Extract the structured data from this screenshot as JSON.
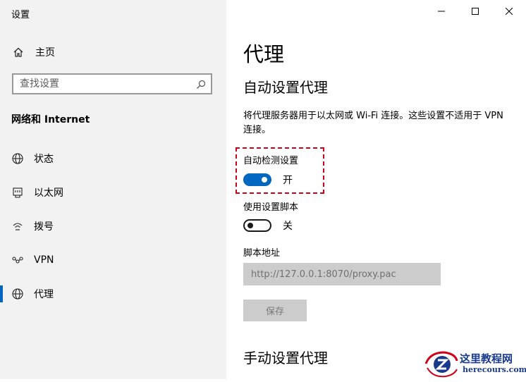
{
  "window": {
    "title": "设置"
  },
  "sidebar": {
    "home_label": "主页",
    "search_placeholder": "查找设置",
    "section_title": "网络和 Internet",
    "items": [
      {
        "label": "状态",
        "icon": "globe-status-icon",
        "active": false
      },
      {
        "label": "以太网",
        "icon": "ethernet-icon",
        "active": false
      },
      {
        "label": "拨号",
        "icon": "dialup-icon",
        "active": false
      },
      {
        "label": "VPN",
        "icon": "vpn-icon",
        "active": false
      },
      {
        "label": "代理",
        "icon": "globe-icon",
        "active": true
      }
    ]
  },
  "main": {
    "page_title": "代理",
    "auto_section_title": "自动设置代理",
    "auto_description": "将代理服务器用于以太网或 Wi-Fi 连接。这些设置不适用于 VPN 连接。",
    "auto_detect": {
      "label": "自动检测设置",
      "state": "开",
      "on": true
    },
    "use_script": {
      "label": "使用设置脚本",
      "state": "关",
      "on": false
    },
    "script_address": {
      "label": "脚本地址",
      "value": "http://127.0.0.1:8070/proxy.pac"
    },
    "save_label": "保存",
    "manual_section_title": "手动设置代理"
  },
  "watermark": {
    "title": "这里教程网",
    "url": "herecours.com"
  },
  "colors": {
    "accent": "#0067c0",
    "highlight": "#d0021b",
    "sidebar_bg": "#f2f2f2",
    "disabled_bg": "#cccccc"
  }
}
